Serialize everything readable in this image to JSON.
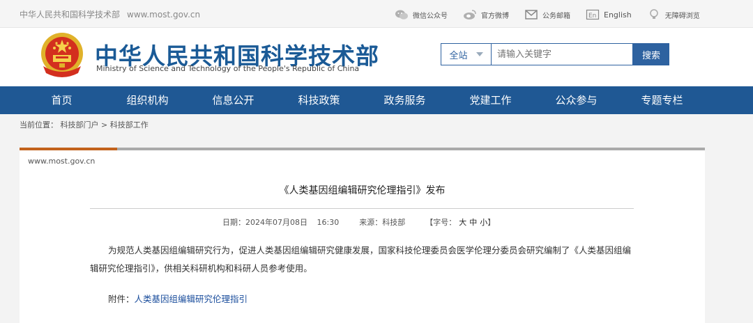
{
  "topbar": {
    "site_name": "中华人民共和国科学技术部",
    "site_url": "www.most.gov.cn",
    "links": [
      {
        "icon": "wechat-icon",
        "label": "微信公众号"
      },
      {
        "icon": "weibo-icon",
        "label": "官方微博"
      },
      {
        "icon": "mail-icon",
        "label": "公务邮箱"
      },
      {
        "icon": "english-icon",
        "label": "English"
      },
      {
        "icon": "accessibility-icon",
        "label": "无障碍浏览"
      }
    ]
  },
  "header": {
    "title_cn": "中华人民共和国科学技术部",
    "title_en": "Ministry of Science and Technology of the People's Republic of China",
    "search": {
      "scope": "全站",
      "placeholder": "请输入关键字",
      "button": "搜索"
    }
  },
  "nav": [
    "首页",
    "组织机构",
    "信息公开",
    "科技政策",
    "政务服务",
    "党建工作",
    "公众参与",
    "专题专栏"
  ],
  "breadcrumb": {
    "prefix": "当前位置：",
    "items": [
      "科技部门户",
      "科技部工作"
    ],
    "sep": " > "
  },
  "article": {
    "source_url": "www.most.gov.cn",
    "title": "《人类基因组编辑研究伦理指引》发布",
    "date_label": "日期：",
    "date": "2024年07月08日",
    "time": "16:30",
    "source_label": "来源：",
    "source": "科技部",
    "font_label": "【字号：",
    "font_sizes": [
      "大",
      "中",
      "小"
    ],
    "font_close": "】",
    "body": "为规范人类基因组编辑研究行为，促进人类基因组编辑研究健康发展，国家科技伦理委员会医学伦理分委员会研究编制了《人类基因组编辑研究伦理指引》，供相关科研机构和科研人员参考使用。",
    "attachment_label": "附件：",
    "attachment_link": "人类基因组编辑研究伦理指引"
  },
  "colors": {
    "brand_blue": "#1f5894",
    "accent_orange": "#c2621c",
    "link_blue": "#1a4d9c"
  }
}
